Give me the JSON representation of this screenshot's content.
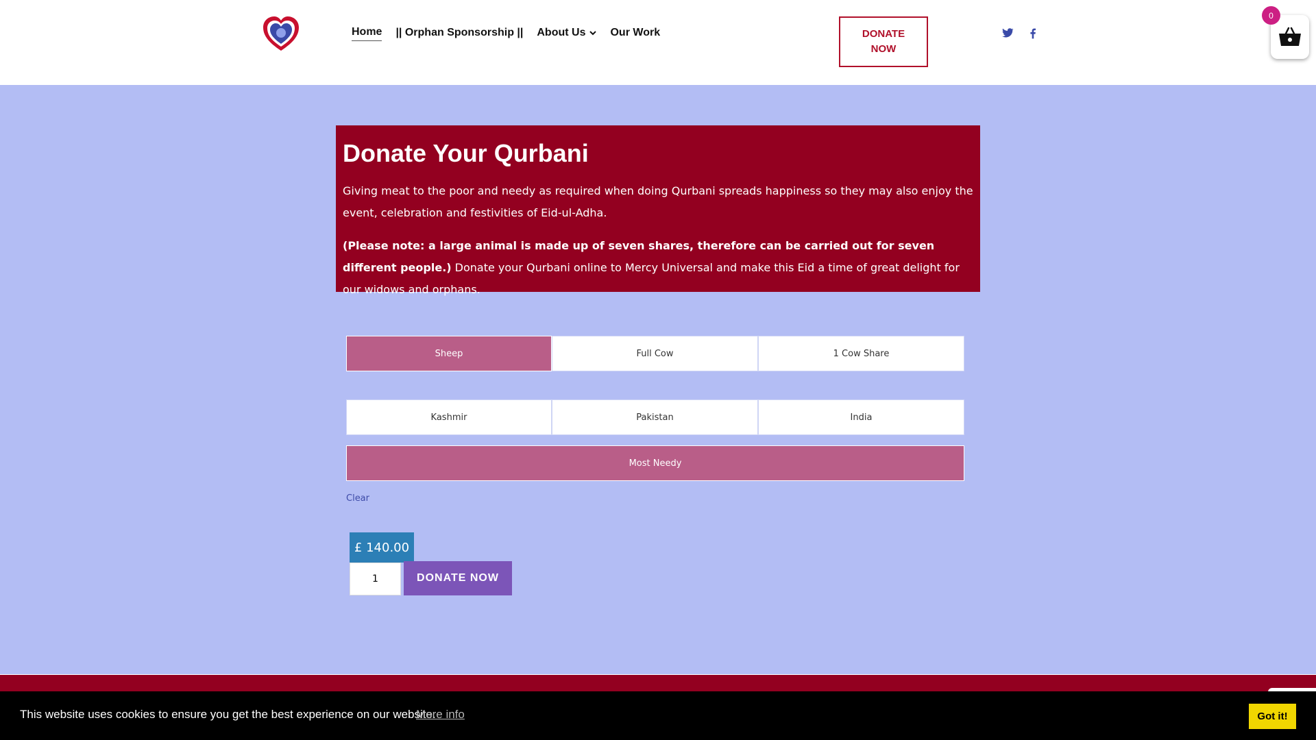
{
  "header": {
    "nav": [
      {
        "label": "Home",
        "active": true
      },
      {
        "label": "|| Orphan Sponsorship ||"
      },
      {
        "label": "About Us",
        "dropdown": true
      },
      {
        "label": "Our Work"
      }
    ],
    "donate_label": "DONATE NOW",
    "social": [
      "twitter-icon",
      "facebook-icon"
    ],
    "cart_count": "0"
  },
  "hero": {
    "title": "Donate Your Qurbani",
    "para1": "Giving meat to the poor and needy as required when doing Qurbani spreads happiness so they may also enjoy the event, celebration and festivities of Eid-ul-Adha.",
    "note_bold": "(Please note: a large animal is made up of seven shares, therefore can be carried out for seven different people.)",
    "note_rest": " Donate your Qurbani online to Mercy Universal and make this Eid a time of great delight for our widows and orphans."
  },
  "product": {
    "animals": [
      "Sheep",
      "Full Cow",
      "1 Cow Share"
    ],
    "selected_animal": "Sheep",
    "regions": [
      "Kashmir",
      "Pakistan",
      "India"
    ],
    "most_needy": "Most Needy",
    "selected_region": "Most Needy",
    "clear_label": "Clear",
    "price": "£ 140.00",
    "quantity": "1",
    "donate_label": "DONATE NOW"
  },
  "cookie": {
    "text": "This website uses cookies to ensure you get the best experience on our website.",
    "more_label": "More info",
    "accept_label": "Got it!"
  },
  "colors": {
    "hero_bg": "#930020",
    "page_bg": "#b3bdf4",
    "selected_option": "#b95e88",
    "price_bg": "#2c7fb6",
    "donate_bg": "#7c55b8",
    "cookie_button": "#f1d600"
  }
}
